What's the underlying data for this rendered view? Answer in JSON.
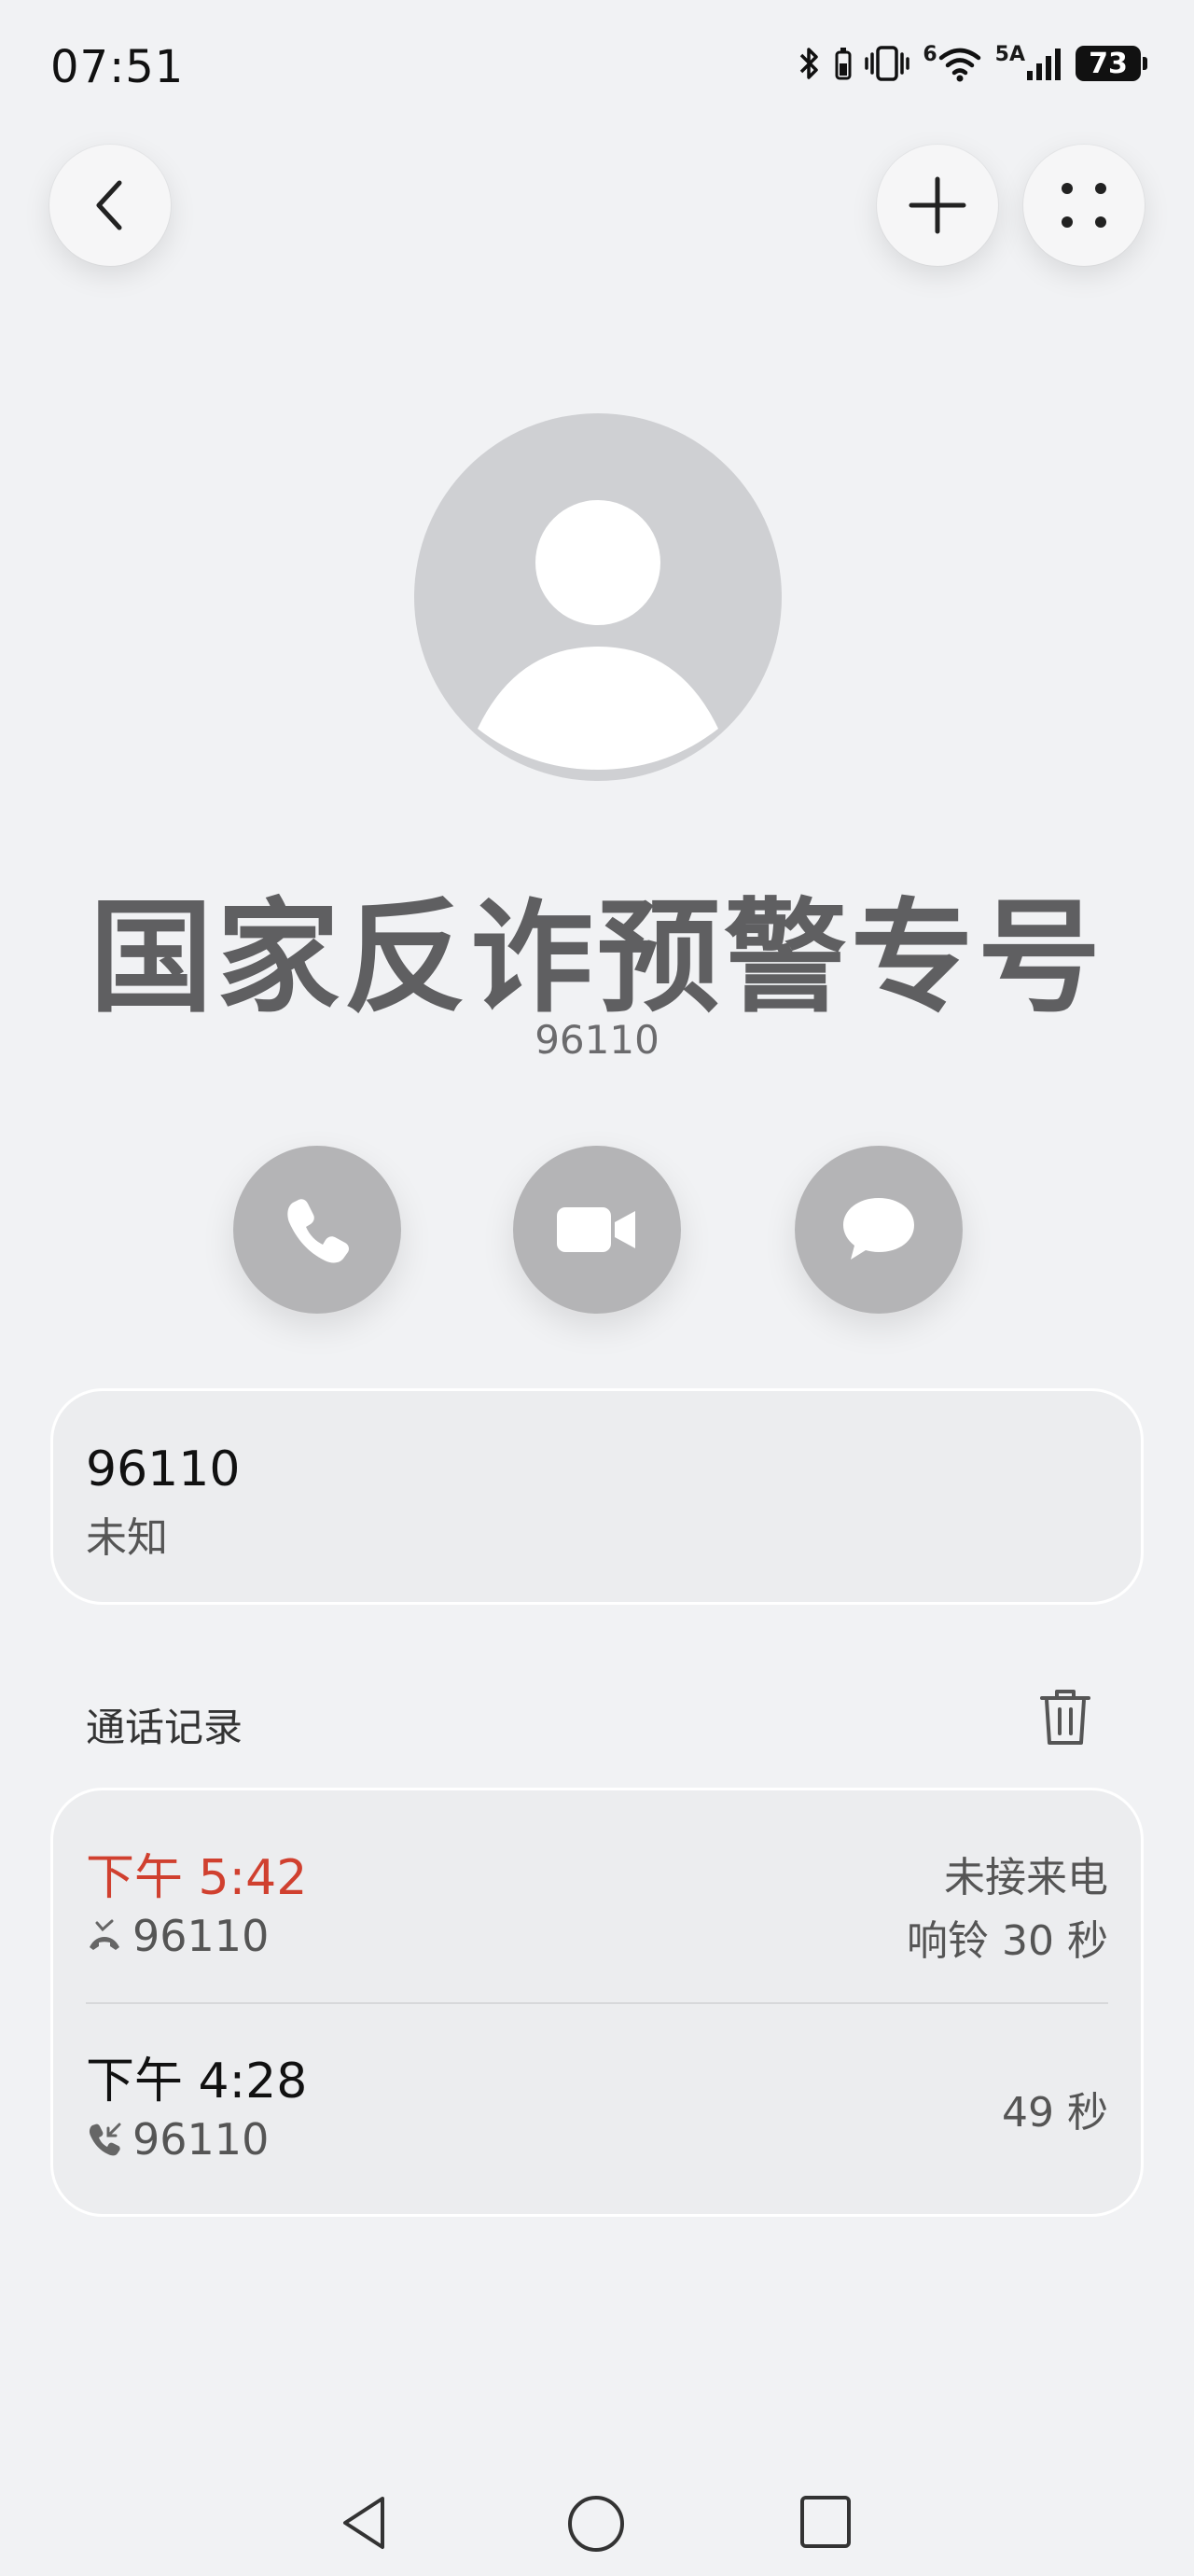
{
  "status_bar": {
    "time": "07:51",
    "network_label": "5A",
    "signal_prefix": "6",
    "battery": "73"
  },
  "contact": {
    "name": "国家反诈预警专号",
    "subtitle": "96110"
  },
  "number_card": {
    "number": "96110",
    "label": "未知"
  },
  "call_history": {
    "title": "通话记录",
    "records": [
      {
        "time": "下午 5:42",
        "number": "96110",
        "status": "未接来电",
        "detail": "响铃 30 秒",
        "missed": true
      },
      {
        "time": "下午 4:28",
        "number": "96110",
        "status": "",
        "detail": "49 秒",
        "missed": false
      }
    ]
  },
  "colors": {
    "background": "#f1f2f4",
    "missed_red": "#d0402f",
    "avatar_gray": "#cfd0d3",
    "action_gray": "#b4b4b6"
  }
}
